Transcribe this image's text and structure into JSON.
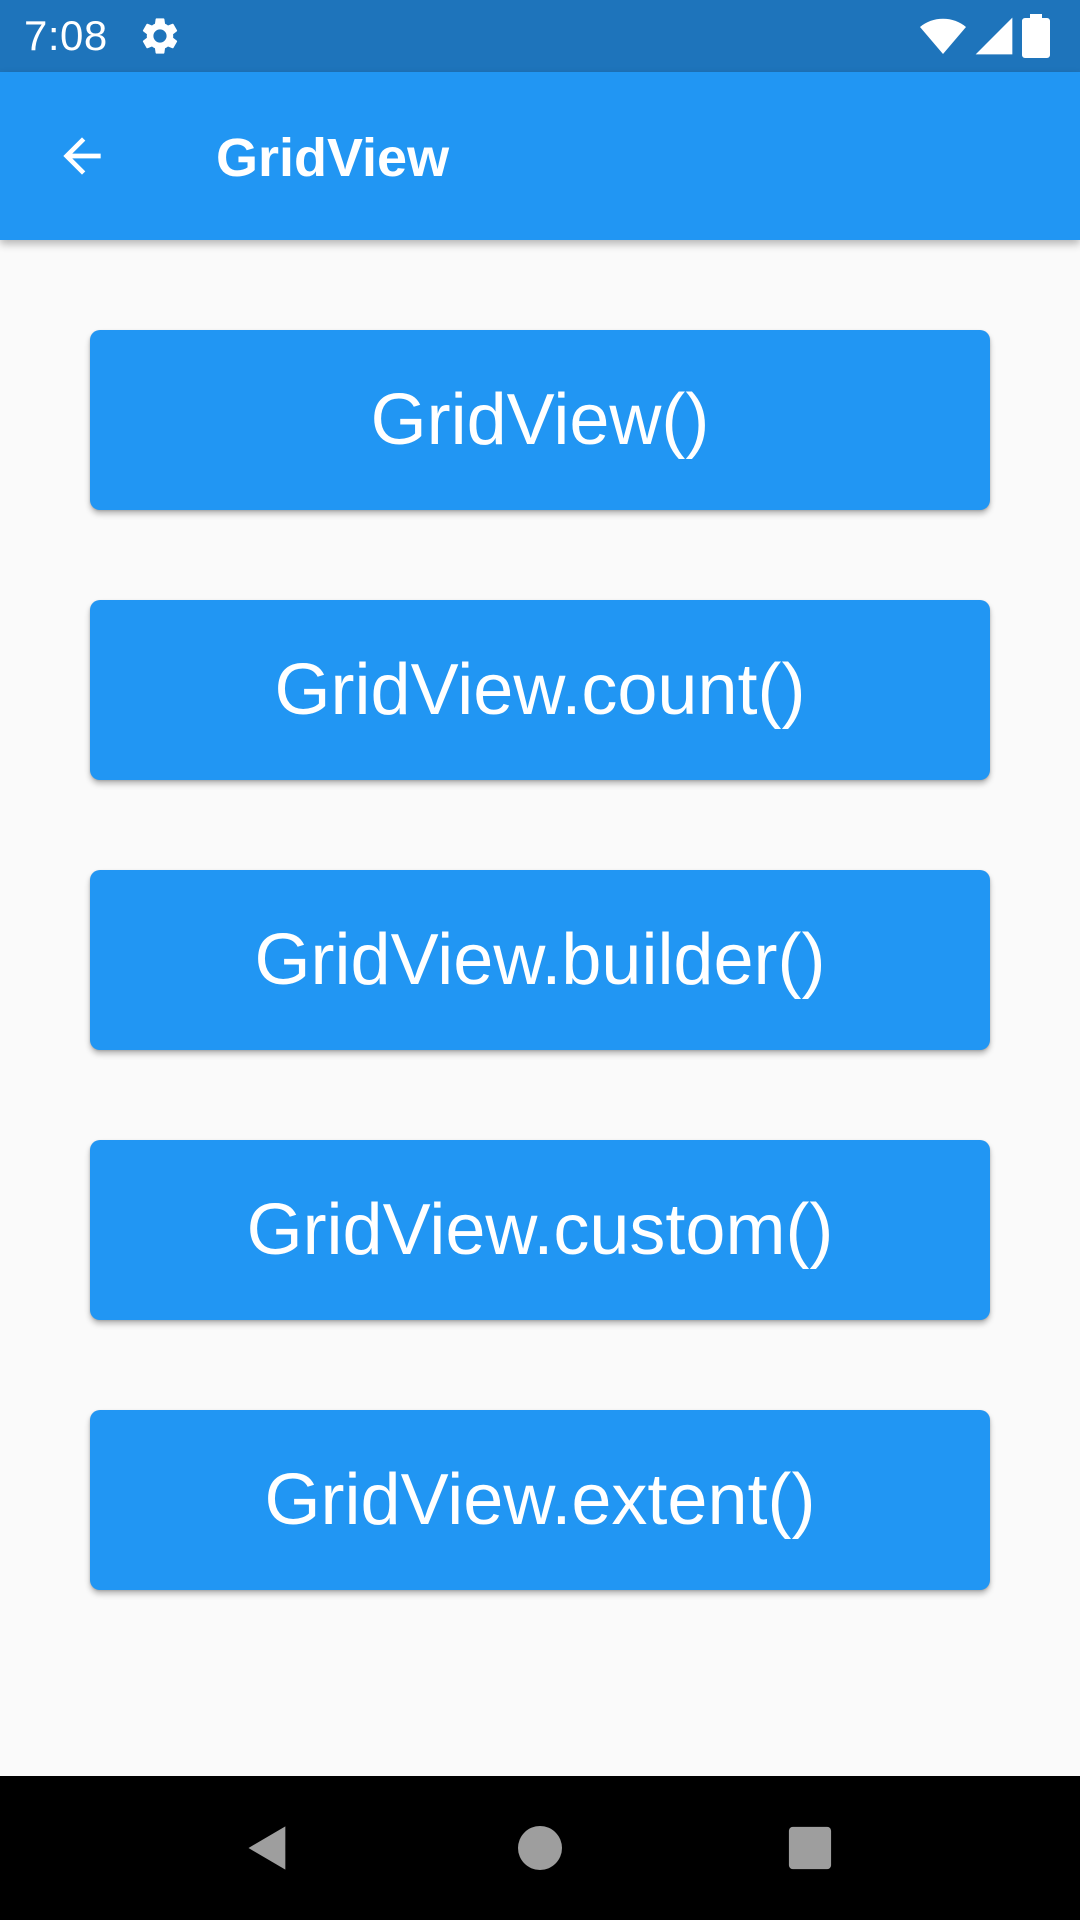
{
  "status_bar": {
    "time": "7:08",
    "icons": [
      "gear-icon",
      "wifi-icon",
      "cell-signal-icon",
      "battery-icon"
    ]
  },
  "app_bar": {
    "title": "GridView",
    "back_icon": "arrow-back-icon"
  },
  "buttons": [
    {
      "label": "GridView()"
    },
    {
      "label": "GridView.count()"
    },
    {
      "label": "GridView.builder()"
    },
    {
      "label": "GridView.custom()"
    },
    {
      "label": "GridView.extent()"
    }
  ],
  "nav_bar": {
    "icons": [
      "back-triangle-icon",
      "home-circle-icon",
      "recents-square-icon"
    ]
  },
  "colors": {
    "status_bar": "#1e74bb",
    "primary": "#2196f3",
    "background": "#fafafa",
    "nav_bar": "#000000",
    "nav_icon": "#9e9e9e"
  }
}
